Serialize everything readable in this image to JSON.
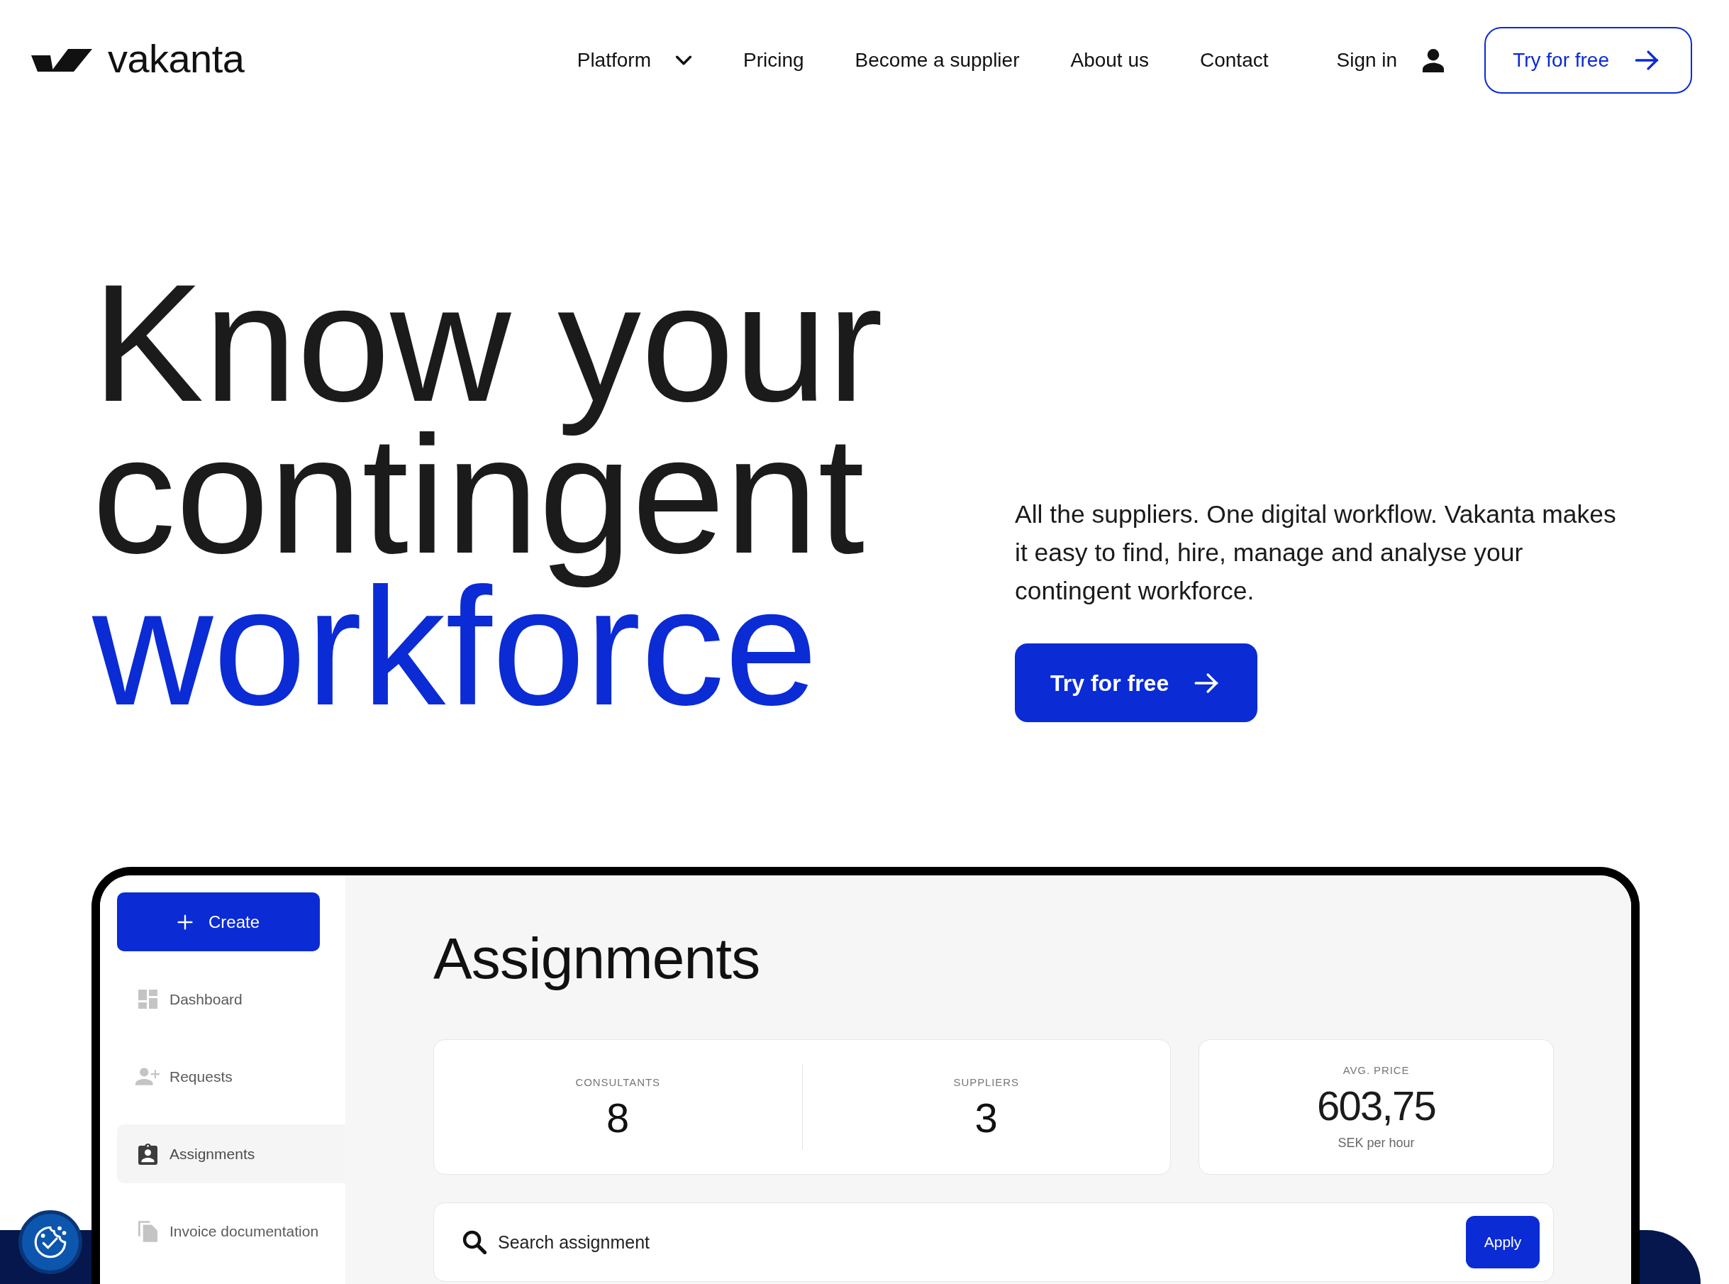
{
  "header": {
    "logo": {
      "text": "vakanta"
    },
    "nav": [
      {
        "label": "Platform",
        "kind": "dropdown"
      },
      {
        "label": "Pricing",
        "kind": "link"
      },
      {
        "label": "Become a supplier",
        "kind": "link"
      },
      {
        "label": "About us",
        "kind": "link"
      },
      {
        "label": "Contact",
        "kind": "link"
      }
    ],
    "sign_in": {
      "label": "Sign in"
    },
    "cta": {
      "label": "Try for free"
    }
  },
  "hero": {
    "headline": [
      {
        "text": "Know your",
        "highlight": false
      },
      {
        "text": "contingent",
        "highlight": false
      },
      {
        "text": "workforce",
        "highlight": true
      }
    ],
    "description": "All the suppliers. One digital workflow. Vakanta makes it easy to find, hire, manage and analyse your contingent workforce.",
    "cta": {
      "label": "Try for free"
    }
  },
  "app_preview": {
    "sidebar": {
      "create_button": {
        "label": "Create"
      },
      "items": [
        {
          "label": "Dashboard",
          "selected": false
        },
        {
          "label": "Requests",
          "selected": false
        },
        {
          "label": "Assignments",
          "selected": true
        },
        {
          "label": "Invoice documentation",
          "selected": false
        }
      ]
    },
    "title": "Assignments",
    "counts": [
      {
        "label": "CONSULTANTS",
        "value": "8"
      },
      {
        "label": "SUPPLIERS",
        "value": "3"
      }
    ],
    "avg_price": {
      "label": "AVG. PRICE",
      "value": "603,75",
      "unit": "SEK per hour"
    },
    "search": {
      "placeholder": "Search assignment",
      "button": "Apply"
    }
  }
}
